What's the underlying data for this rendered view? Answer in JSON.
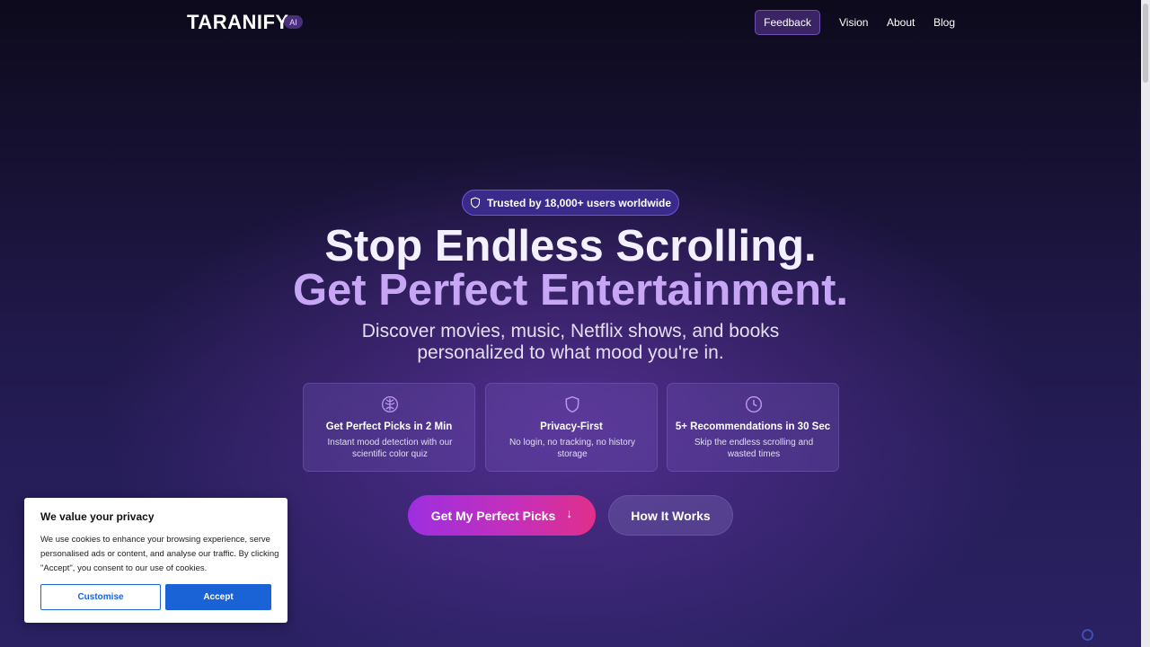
{
  "nav": {
    "logo": "TARANIFY",
    "ai_badge": "AI",
    "feedback": "Feedback",
    "links": [
      "Vision",
      "About",
      "Blog"
    ]
  },
  "hero": {
    "trust_pill": "Trusted by 18,000+ users worldwide",
    "headline_1": "Stop Endless Scrolling.",
    "headline_2": "Get Perfect Entertainment.",
    "sub_1": "Discover movies, music, Netflix shows, and books",
    "sub_2": "personalized to what mood you're in."
  },
  "cards": [
    {
      "icon": "brain-icon",
      "title": "Get Perfect Picks in 2 Min",
      "desc": "Instant mood detection with our scientific color quiz"
    },
    {
      "icon": "shield-icon",
      "title": "Privacy-First",
      "desc": "No login, no tracking, no history storage"
    },
    {
      "icon": "clock-icon",
      "title": "5+ Recommendations in 30 Sec",
      "desc": "Skip the endless scrolling and wasted times"
    }
  ],
  "cta": {
    "primary": "Get My Perfect Picks",
    "primary_arrow": "↓",
    "secondary": "How It Works"
  },
  "cookie": {
    "title": "We value your privacy",
    "text": "We use cookies to enhance your browsing experience, serve personalised ads or content, and analyse our traffic. By clicking \"Accept\", you consent to our use of cookies.",
    "customise": "Customise",
    "accept": "Accept"
  },
  "colors": {
    "accent_purple": "#c7a6f5",
    "cta_gradient_start": "#9d2fe0",
    "cta_gradient_end": "#e02f8a",
    "cookie_blue": "#1a63d6"
  }
}
